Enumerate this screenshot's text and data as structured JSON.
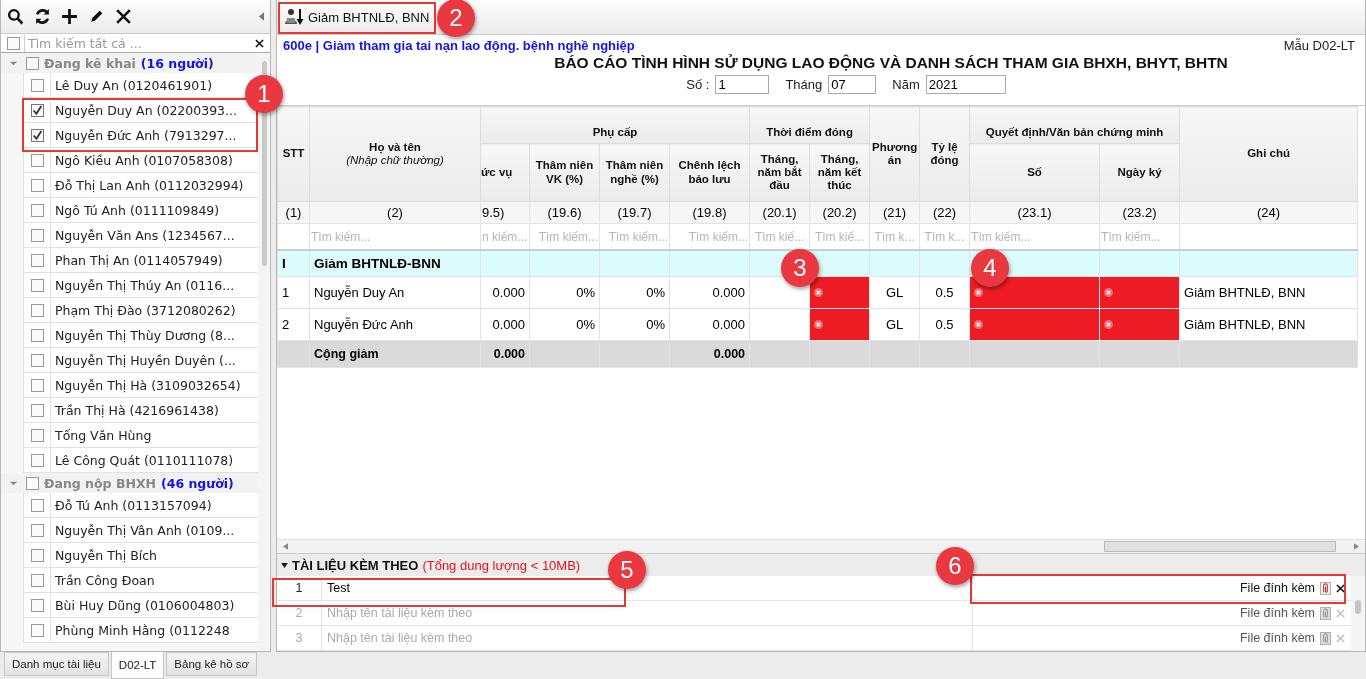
{
  "sidebar": {
    "search": {
      "placeholder": "Tìm kiếm tất cả ...",
      "checked": false
    },
    "groups": [
      {
        "label": "Đang kê khai",
        "count": "(16 người)",
        "expanded": true,
        "checked": false,
        "children": [
          {
            "label": "Lê Duy An (0120461901)",
            "checked": false
          },
          {
            "label": "Nguyễn Duy An (02200393...",
            "checked": true
          },
          {
            "label": "Nguyễn Đức Anh (7913297...",
            "checked": true
          },
          {
            "label": "Ngô Kiều Anh (0107058308)",
            "checked": false
          },
          {
            "label": "Đỗ Thị Lan Anh (0112032994)",
            "checked": false
          },
          {
            "label": "Ngô Tú Anh (0111109849)",
            "checked": false
          },
          {
            "label": "Nguyễn Văn Ans (1234567...",
            "checked": false
          },
          {
            "label": "Phan Thị An (0114057949)",
            "checked": false
          },
          {
            "label": "Nguyễn Thị Thúy An (0116...",
            "checked": false
          },
          {
            "label": "Phạm Thị Đào (3712080262)",
            "checked": false
          },
          {
            "label": "Nguyễn Thị Thùy Dương (8...",
            "checked": false
          },
          {
            "label": "Nguyễn Thị Huyền Duyên (...",
            "checked": false
          },
          {
            "label": "Nguyễn Thị Hà (3109032654)",
            "checked": false
          },
          {
            "label": "Trần Thị Hà (4216961438)",
            "checked": false
          },
          {
            "label": "Tống Văn Hùng",
            "checked": false
          },
          {
            "label": "Lê Công Quát (0110111078)",
            "checked": false
          }
        ]
      },
      {
        "label": "Đang nộp BHXH",
        "count": "(46 người)",
        "expanded": true,
        "checked": false,
        "children": [
          {
            "label": "Đỗ Tú Anh (0113157094)",
            "checked": false
          },
          {
            "label": "Nguyễn Thị Vân Anh (0109...",
            "checked": false
          },
          {
            "label": "Nguyễn Thị Bích",
            "checked": false
          },
          {
            "label": "Trần Công Đoan",
            "checked": false
          },
          {
            "label": "Bùi Huy Dũng (0106004803)",
            "checked": false
          },
          {
            "label": "Phùng Minh Hằng (0112248",
            "checked": false
          }
        ]
      }
    ]
  },
  "bottom_tabs": [
    {
      "label": "Danh mục tài liệu",
      "selected": false
    },
    {
      "label": "D02-LT",
      "selected": true
    },
    {
      "label": "Bảng kê hồ sơ",
      "selected": false
    }
  ],
  "toolbar": {
    "button": "Giảm BHTNLĐ, BNN"
  },
  "report": {
    "subtitle": "600e | Giảm tham gia tai nạn lao động. bệnh nghề nghiệp",
    "form_code": "Mẫu D02-LT",
    "title": "BÁO CÁO TÌNH HÌNH SỬ DỤNG LAO ĐỘNG VÀ DANH SÁCH THAM GIA BHXH, BHYT, BHTN",
    "fields": [
      {
        "label": "Số :",
        "value": "1"
      },
      {
        "label": "Tháng",
        "value": "07"
      },
      {
        "label": "Năm",
        "value": "2021"
      }
    ]
  },
  "table": {
    "header": [
      {
        "kind": "column",
        "label": "STT",
        "number": "(1)"
      },
      {
        "kind": "column",
        "label": "Họ và tên",
        "hint": "(Nhập chữ thường)",
        "number": "(2)",
        "search_placeholder": "Tìm kiếm..."
      },
      {
        "kind": "group",
        "label": "Phụ cấp",
        "columns": [
          {
            "label": "ức vụ",
            "number": "9.5)",
            "search_placeholder": "n kiếm..."
          },
          {
            "label": "Thâm niên VK (%)",
            "number": "(19.6)",
            "search_placeholder": "Tìm kiếm..."
          },
          {
            "label": "Thâm niên nghề (%)",
            "number": "(19.7)",
            "search_placeholder": "Tìm kiếm..."
          },
          {
            "label": "Chênh lệch bảo lưu",
            "number": "(19.8)",
            "search_placeholder": "Tìm kiếm..."
          }
        ]
      },
      {
        "kind": "group",
        "label": "Thời điểm đóng",
        "columns": [
          {
            "label": "Tháng, năm bắt đầu",
            "number": "(20.1)",
            "search_placeholder": "Tìm kiế..."
          },
          {
            "label": "Tháng, năm kết thúc",
            "number": "(20.2)",
            "search_placeholder": "Tìm kiế..."
          }
        ]
      },
      {
        "kind": "column",
        "label": "Phương án",
        "number": "(21)",
        "search_placeholder": "Tìm k..."
      },
      {
        "kind": "column",
        "label": "Tỷ lệ đóng",
        "number": "(22)",
        "search_placeholder": "Tìm k..."
      },
      {
        "kind": "group",
        "label": "Quyết định/Văn bản chứng minh",
        "columns": [
          {
            "label": "Số",
            "number": "(23.1)",
            "search_placeholder": "Tìm kiếm..."
          },
          {
            "label": "Ngày ký",
            "number": "(23.2)",
            "search_placeholder": "Tìm kiếm..."
          }
        ]
      },
      {
        "kind": "column",
        "label": "Ghi chú",
        "number": "(24)"
      }
    ],
    "rows": [
      {
        "kind": "group",
        "cells": [
          {
            "text": "I",
            "error": false
          },
          {
            "text": "Giảm BHTNLĐ-BNN",
            "error": false
          },
          {
            "error": false
          },
          {
            "error": false
          },
          {
            "error": false
          },
          {
            "error": false
          },
          {
            "error": false
          },
          {
            "error": false
          },
          {
            "error": false
          },
          {
            "error": false
          },
          {
            "error": false
          },
          {
            "error": false
          },
          {
            "error": false
          }
        ]
      },
      {
        "kind": "data",
        "cells": [
          {
            "text": "1",
            "error": false
          },
          {
            "text": "Nguyễn Duy An",
            "error": false
          },
          {
            "text": "0.000",
            "error": false
          },
          {
            "text": "0%",
            "error": false
          },
          {
            "text": "0%",
            "error": false
          },
          {
            "text": "0.000",
            "error": false
          },
          {
            "error": false
          },
          {
            "error": true
          },
          {
            "text": "GL",
            "error": false
          },
          {
            "text": "0.5",
            "error": false
          },
          {
            "error": true
          },
          {
            "error": true
          },
          {
            "text": "Giảm BHTNLĐ, BNN",
            "error": false
          }
        ]
      },
      {
        "kind": "data",
        "cells": [
          {
            "text": "2",
            "error": false
          },
          {
            "text": "Nguyễn Đức Anh",
            "error": false
          },
          {
            "text": "0.000",
            "error": false
          },
          {
            "text": "0%",
            "error": false
          },
          {
            "text": "0%",
            "error": false
          },
          {
            "text": "0.000",
            "error": false
          },
          {
            "error": false
          },
          {
            "error": true
          },
          {
            "text": "GL",
            "error": false
          },
          {
            "text": "0.5",
            "error": false
          },
          {
            "error": true
          },
          {
            "error": true
          },
          {
            "text": "Giảm BHTNLĐ, BNN",
            "error": false
          }
        ]
      },
      {
        "kind": "total",
        "cells": [
          {
            "error": false
          },
          {
            "text": "Cộng giảm",
            "error": false
          },
          {
            "text": "0.000",
            "error": false
          },
          {
            "error": false
          },
          {
            "error": false
          },
          {
            "text": "0.000",
            "error": false
          },
          {
            "error": false
          },
          {
            "error": false
          },
          {
            "error": false
          },
          {
            "error": false
          },
          {
            "error": false
          },
          {
            "error": false
          },
          {
            "error": false
          }
        ]
      }
    ]
  },
  "attachments": {
    "title": "TÀI LIỆU KÈM THEO",
    "note": "(Tổng dung lượng < 10MB)",
    "expanded": true,
    "rows": [
      {
        "index": "1",
        "name": "Test",
        "file_label": "File đính kèm",
        "disabled": false
      },
      {
        "index": "2",
        "placeholder": "Nhập tên tài liệu kèm theo",
        "file_label": "File đính kèm",
        "disabled": true
      },
      {
        "index": "3",
        "placeholder": "Nhập tên tài liệu kèm theo",
        "file_label": "File đính kèm",
        "disabled": true
      }
    ]
  },
  "annotations": [
    {
      "label": "1",
      "box": true
    },
    {
      "label": "2",
      "box": true
    },
    {
      "label": "3",
      "box": false
    },
    {
      "label": "4",
      "box": false
    },
    {
      "label": "5",
      "box": true
    },
    {
      "label": "6",
      "box": true
    }
  ]
}
